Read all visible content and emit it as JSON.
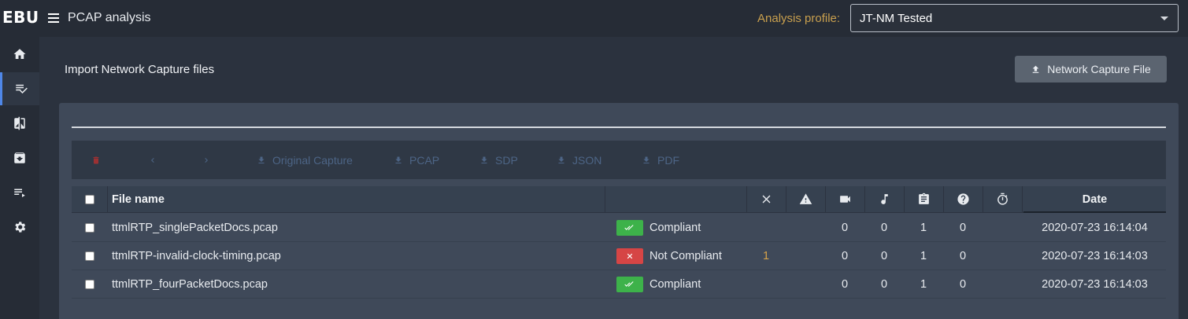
{
  "header": {
    "logo": "EBU",
    "app_title": "PCAP analysis",
    "profile_label": "Analysis profile:",
    "profile_value": "JT-NM Tested"
  },
  "sidebar": {
    "items": [
      {
        "icon": "home-icon",
        "active": false
      },
      {
        "icon": "playlist-check-icon",
        "active": true
      },
      {
        "icon": "compare-icon",
        "active": false
      },
      {
        "icon": "archive-icon",
        "active": false
      },
      {
        "icon": "playlist-play-icon",
        "active": false
      },
      {
        "icon": "gear-icon",
        "active": false
      }
    ]
  },
  "main": {
    "section_title": "Import Network Capture files",
    "upload_label": "Network Capture File"
  },
  "toolbar": {
    "original_capture": "Original Capture",
    "pcap": "PCAP",
    "sdp": "SDP",
    "json": "JSON",
    "pdf": "PDF"
  },
  "table": {
    "columns": {
      "file_name": "File name",
      "date": "Date",
      "icon_columns": [
        "close-icon",
        "warning-icon",
        "video-icon",
        "music-note-icon",
        "clipboard-icon",
        "help-circle-icon",
        "timer-icon"
      ]
    },
    "rows": [
      {
        "file": "ttmlRTP_singlePacketDocs.pcap",
        "status": "Compliant",
        "compliant": true,
        "errors": "",
        "warnings": "",
        "video": "0",
        "audio": "0",
        "ancillary": "1",
        "unknown": "0",
        "ttml": "",
        "date": "2020-07-23 16:14:04"
      },
      {
        "file": "ttmlRTP-invalid-clock-timing.pcap",
        "status": "Not Compliant",
        "compliant": false,
        "errors": "1",
        "warnings": "",
        "video": "0",
        "audio": "0",
        "ancillary": "1",
        "unknown": "0",
        "ttml": "",
        "date": "2020-07-23 16:14:03"
      },
      {
        "file": "ttmlRTP_fourPacketDocs.pcap",
        "status": "Compliant",
        "compliant": true,
        "errors": "",
        "warnings": "",
        "video": "0",
        "audio": "0",
        "ancillary": "1",
        "unknown": "0",
        "ttml": "",
        "date": "2020-07-23 16:14:03"
      }
    ]
  },
  "colors": {
    "accent": "#4f87e8",
    "compliant": "#3db24a",
    "not_compliant": "#d64545",
    "profile_label": "#c9a04e",
    "error_count": "#d5a24a"
  }
}
